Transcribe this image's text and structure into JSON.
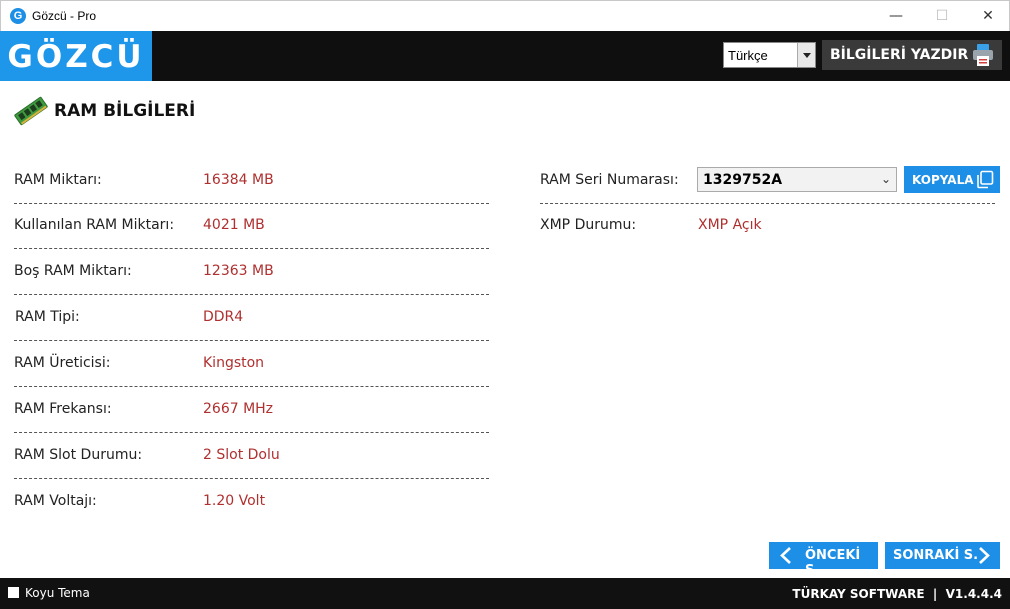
{
  "window": {
    "title": "Gözcü - Pro",
    "app_icon_letter": "G",
    "minimize": "—",
    "maximize": "☐",
    "close": "✕"
  },
  "header": {
    "logo": "GÖZCÜ",
    "language": "Türkçe",
    "print_label": "BİLGİLERİ YAZDIR"
  },
  "section": {
    "title": "RAM BİLGİLERİ",
    "icon": "ram-module-icon"
  },
  "left_rows": [
    {
      "label": "RAM Miktarı:",
      "value": "16384 MB"
    },
    {
      "label": "Kullanılan RAM Miktarı:",
      "value": "4021 MB"
    },
    {
      "label": "Boş RAM Miktarı:",
      "value": "12363 MB"
    },
    {
      "label": "RAM Tipi:",
      "value": "DDR4"
    },
    {
      "label": "RAM Üreticisi:",
      "value": "Kingston"
    },
    {
      "label": "RAM Frekansı:",
      "value": "2667 MHz"
    },
    {
      "label": "RAM Slot Durumu:",
      "value": "2 Slot Dolu"
    },
    {
      "label": "RAM Voltajı:",
      "value": "1.20 Volt"
    }
  ],
  "right_rows": {
    "serial_label": "RAM Seri Numarası:",
    "serial_value": "1329752A",
    "copy_label": "KOPYALA",
    "xmp_label": "XMP Durumu:",
    "xmp_value": "XMP Açık"
  },
  "nav": {
    "prev_label": "ÖNCEKİ S.",
    "next_label": "SONRAKİ S."
  },
  "footer": {
    "dark_theme_label": "Koyu Tema",
    "dark_theme_checked": false,
    "company": "TÜRKAY SOFTWARE  |  V1.4.4.4"
  },
  "colors": {
    "accent": "#1e8fe6",
    "value_red": "#b02f2f",
    "header_bg": "#0f0f0f"
  }
}
